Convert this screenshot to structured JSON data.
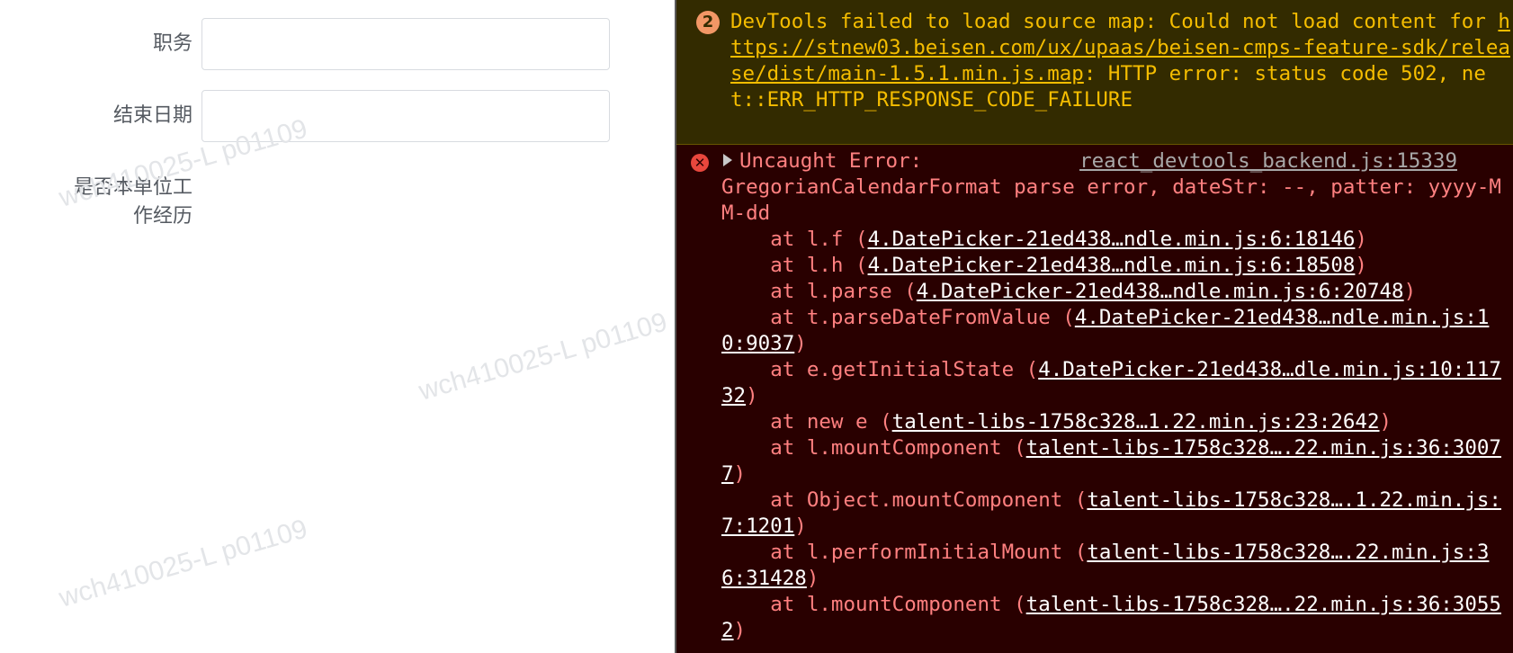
{
  "form": {
    "fields": [
      {
        "label": "职务",
        "value": ""
      },
      {
        "label": "结束日期",
        "value": ""
      },
      {
        "label": "是否本单位工作经历"
      }
    ],
    "watermark": "wch410025-L p01109"
  },
  "console": {
    "warning": {
      "count": "2",
      "prefix": "DevTools failed to load source map: Could not load content for ",
      "url": "https://stnew03.beisen.com/ux/upaas/beisen-cmps-feature-sdk/release/dist/main-1.5.1.min.js.map",
      "suffix": ": HTTP error: status code 502, net::ERR_HTTP_RESPONSE_CODE_FAILURE"
    },
    "error": {
      "title": "Uncaught Error:",
      "source": "react_devtools_backend.js:15339",
      "message": "GregorianCalendarFormat parse error, dateStr: --, patter: yyyy-MM-dd",
      "stack": [
        {
          "fn": "at l.f",
          "src": "4.DatePicker-21ed438…ndle.min.js:6:18146"
        },
        {
          "fn": "at l.h",
          "src": "4.DatePicker-21ed438…ndle.min.js:6:18508"
        },
        {
          "fn": "at l.parse",
          "src": "4.DatePicker-21ed438…ndle.min.js:6:20748"
        },
        {
          "fn": "at t.parseDateFromValue",
          "src": "4.DatePicker-21ed438…ndle.min.js:10:9037"
        },
        {
          "fn": "at e.getInitialState",
          "src": "4.DatePicker-21ed438…dle.min.js:10:11732"
        },
        {
          "fn": "at new e",
          "src": "talent-libs-1758c328…1.22.min.js:23:2642"
        },
        {
          "fn": "at l.mountComponent",
          "src": "talent-libs-1758c328….22.min.js:36:30077"
        },
        {
          "fn": "at Object.mountComponent",
          "src": "talent-libs-1758c328….1.22.min.js:7:1201"
        },
        {
          "fn": "at l.performInitialMount",
          "src": "talent-libs-1758c328….22.min.js:36:31428"
        },
        {
          "fn": "at l.mountComponent",
          "src": "talent-libs-1758c328….22.min.js:36:30552"
        }
      ]
    }
  }
}
